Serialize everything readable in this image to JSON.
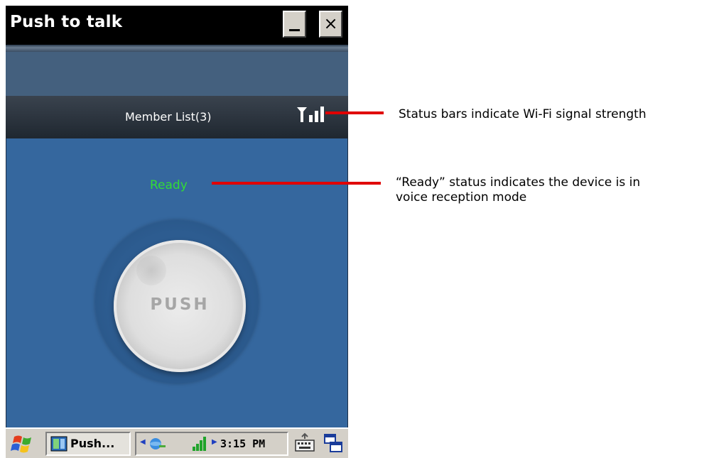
{
  "window": {
    "title": "Push to talk",
    "minimize_label": "_",
    "close_label": "×"
  },
  "header": {
    "member_list": "Member List(3)",
    "signal_icon": "signal-bars-icon"
  },
  "status": {
    "text": "Ready",
    "color": "#32dc36"
  },
  "push_button": {
    "label": "PUSH"
  },
  "taskbar": {
    "start_icon": "windows-flag-icon",
    "active_task": "Push...",
    "clock": "3:15 PM",
    "keyboard_icon": "keyboard-icon",
    "switch_icon": "window-switch-icon"
  },
  "annotations": {
    "signal": "Status bars indicate Wi-Fi signal strength",
    "ready_line1": "“Ready” status indicates the device is in",
    "ready_line2": "voice reception mode"
  },
  "colors": {
    "screen_bg": "#35679e",
    "callout": "#e00000"
  }
}
